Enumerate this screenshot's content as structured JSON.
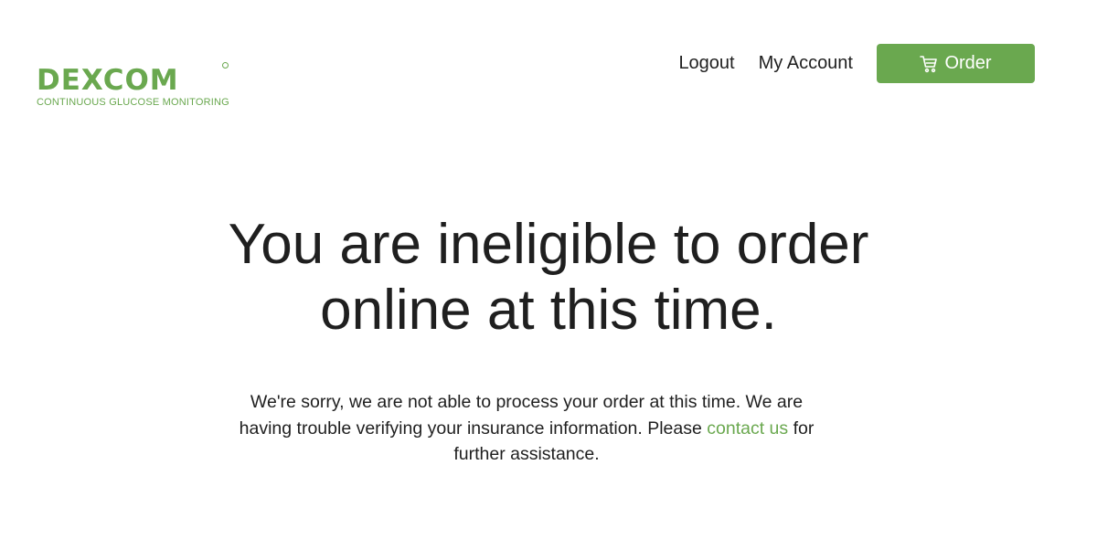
{
  "brand": {
    "name": "DEXCOM",
    "tagline": "CONTINUOUS GLUCOSE MONITORING",
    "color": "#6aa84f"
  },
  "nav": {
    "logout": "Logout",
    "my_account": "My Account",
    "order_label": "Order",
    "order_icon": "cart-icon"
  },
  "main": {
    "headline_line1": "You are ineligible to order",
    "headline_line2": "online at this time.",
    "message_before_link": "We're sorry, we are not able to process your order at this time. We are having trouble verifying your insurance information. Please ",
    "contact_link": "contact us",
    "message_after_link": " for further assistance."
  }
}
